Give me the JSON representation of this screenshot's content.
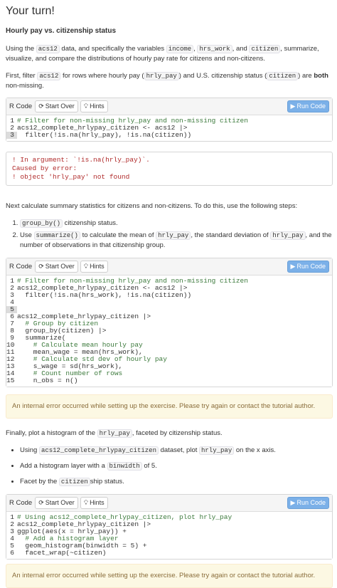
{
  "title": "Your turn!",
  "subtitle": "Hourly pay vs. citizenship status",
  "intro": {
    "t1": "Using the ",
    "c1": "acs12",
    "t2": " data, and specifically the variables ",
    "c2": "income",
    "t3": ", ",
    "c3": "hrs_work",
    "t4": ", and ",
    "c4": "citizen",
    "t5": ", summarize, visualize, and compare the distributions of hourly pay rate for citizens and non-citizens."
  },
  "filter_para": {
    "t1": "First, filter ",
    "c1": "acs12",
    "t2": " for rows where hourly pay (",
    "c2": "hrly_pay",
    "t3": ") and U.S. citizenship status (",
    "c3": "citizen",
    "t4": ") are ",
    "b1": "both",
    "t5": " non-missing."
  },
  "toolbar": {
    "label": "R Code",
    "start_over": "Start Over",
    "hints": "Hints",
    "run": "Run Code"
  },
  "code1": [
    {
      "n": "1",
      "t": "# Filter for non-missing hrly_pay and non-missing citizen",
      "comment": true
    },
    {
      "n": "2",
      "t": "acs12_complete_hrlypay_citizen <- acs12 |>"
    },
    {
      "n": "3",
      "t": "  filter(!is.na(hrly_pay), !is.na(citizen))",
      "active": true
    }
  ],
  "error1": {
    "l1": "! In argument: `!is.na(hrly_pay)`.",
    "l2": "Caused by error:",
    "l3": "! object 'hrly_pay' not found"
  },
  "summary_para": "Next calculate summary statistics for citizens and non-citizens. To do this, use the following steps:",
  "steps": {
    "s1c": "group_by()",
    "s1t": " citizenship status.",
    "s2a": "Use ",
    "s2c1": "summarize()",
    "s2b": " to calculate the mean of ",
    "s2c2": "hrly_pay",
    "s2d": ", the standard deviation of ",
    "s2c3": "hrly_pay",
    "s2e": ", and the number of observations in that citizenship group."
  },
  "code2": [
    {
      "n": "1",
      "t": "# Filter for non-missing hrly_pay and non-missing citizen",
      "comment": true
    },
    {
      "n": "2",
      "t": "acs12_complete_hrlypay_citizen <- acs12 |>"
    },
    {
      "n": "3",
      "t": "  filter(!is.na(hrs_work), !is.na(citizen))"
    },
    {
      "n": "4",
      "t": ""
    },
    {
      "n": "5",
      "t": "",
      "active": true
    },
    {
      "n": "6",
      "t": "acs12_complete_hrlypay_citizen |>"
    },
    {
      "n": "7",
      "t": "  # Group by citizen",
      "comment": true
    },
    {
      "n": "8",
      "t": "  group_by(citizen) |>"
    },
    {
      "n": "9",
      "t": "  summarize("
    },
    {
      "n": "10",
      "t": "    # Calculate mean hourly pay",
      "comment": true
    },
    {
      "n": "11",
      "t": "    mean_wage = mean(hrs_work),"
    },
    {
      "n": "12",
      "t": "    # Calculate std dev of hourly pay",
      "comment": true
    },
    {
      "n": "13",
      "t": "    s_wage = sd(hrs_work),"
    },
    {
      "n": "14",
      "t": "    # Count number of rows",
      "comment": true
    },
    {
      "n": "15",
      "t": "    n_obs = n()"
    }
  ],
  "internal_error": "An internal error occurred while setting up the exercise. Please try again or contact the tutorial author.",
  "plot_para": {
    "t1": "Finally, plot a histogram of the ",
    "c1": "hrly_pay",
    "t2": ", faceted by citizenship status."
  },
  "bullets": {
    "b1a": "Using ",
    "b1c1": "acs12_complete_hrlypay_citizen",
    "b1b": " dataset, plot ",
    "b1c2": "hrly_pay",
    "b1d": " on the x axis.",
    "b2a": "Add a histogram layer with a ",
    "b2c": "binwidth",
    "b2b": " of 5.",
    "b3a": "Facet by the ",
    "b3c": "citizen",
    "b3b": "ship status."
  },
  "code3": [
    {
      "n": "1",
      "t": "# Using acs12_complete_hrlypay_citizen, plot hrly_pay",
      "comment": true
    },
    {
      "n": "2",
      "t": "acs12_complete_hrlypay_citizen |>"
    },
    {
      "n": "3",
      "t": "ggplot(aes(x = hrly_pay)) +"
    },
    {
      "n": "4",
      "t": "  # Add a histogram layer",
      "comment": true
    },
    {
      "n": "5",
      "t": "  geom_histogram(binwidth = 5) +"
    },
    {
      "n": "6",
      "t": "  facet_wrap(~citizen)"
    }
  ]
}
